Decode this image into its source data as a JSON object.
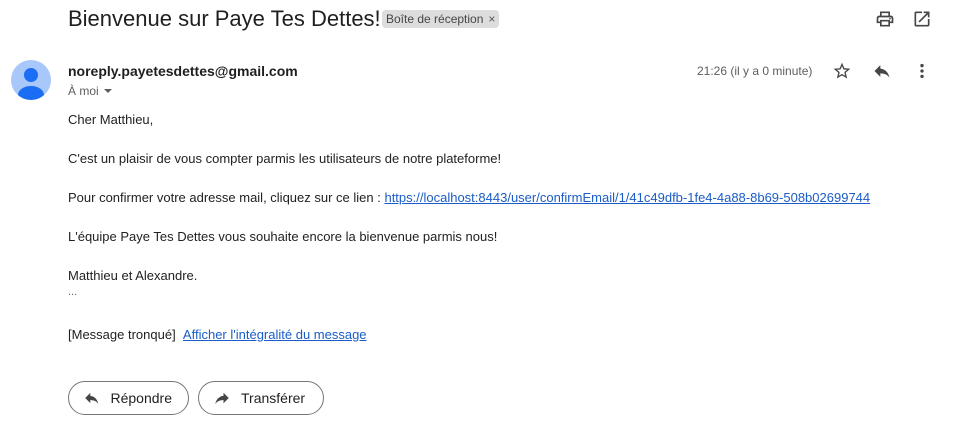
{
  "subject": "Bienvenue sur Paye Tes Dettes!",
  "label": {
    "text": "Boîte de réception",
    "remove": "×"
  },
  "header_icons": [
    "print-icon",
    "open-in-new-window-icon"
  ],
  "sender": {
    "email": "noreply.payetesdettes@gmail.com",
    "recipient": "À moi"
  },
  "time": "21:26 (il y a 0 minute)",
  "message_icons": [
    "star-icon",
    "reply-icon",
    "more-vert-icon"
  ],
  "body": {
    "greeting": "Cher Matthieu,",
    "line1": "C'est un plaisir de vous compter parmis les utilisateurs de notre plateforme!",
    "line2_prefix": "Pour confirmer votre adresse mail, cliquez sur ce lien : ",
    "confirm_link": "https://localhost:8443/user/confirmEmail/1/41c49dfb-1fe4-4a88-8b69-508b02699744",
    "line3": "L'équipe Paye Tes Dettes vous souhaite encore la bienvenue parmis nous!",
    "signature": "Matthieu et Alexandre.",
    "ellipsis": "...",
    "truncated": "[Message tronqué]",
    "show_full": "Afficher l'intégralité du message"
  },
  "actions": {
    "reply": "Répondre",
    "forward": "Transférer"
  },
  "colors": {
    "link": "#1a5cc8",
    "avatar_bg": "#a8c7fa",
    "avatar_fg": "#1b6ef3",
    "chip_bg": "#dddddd"
  }
}
